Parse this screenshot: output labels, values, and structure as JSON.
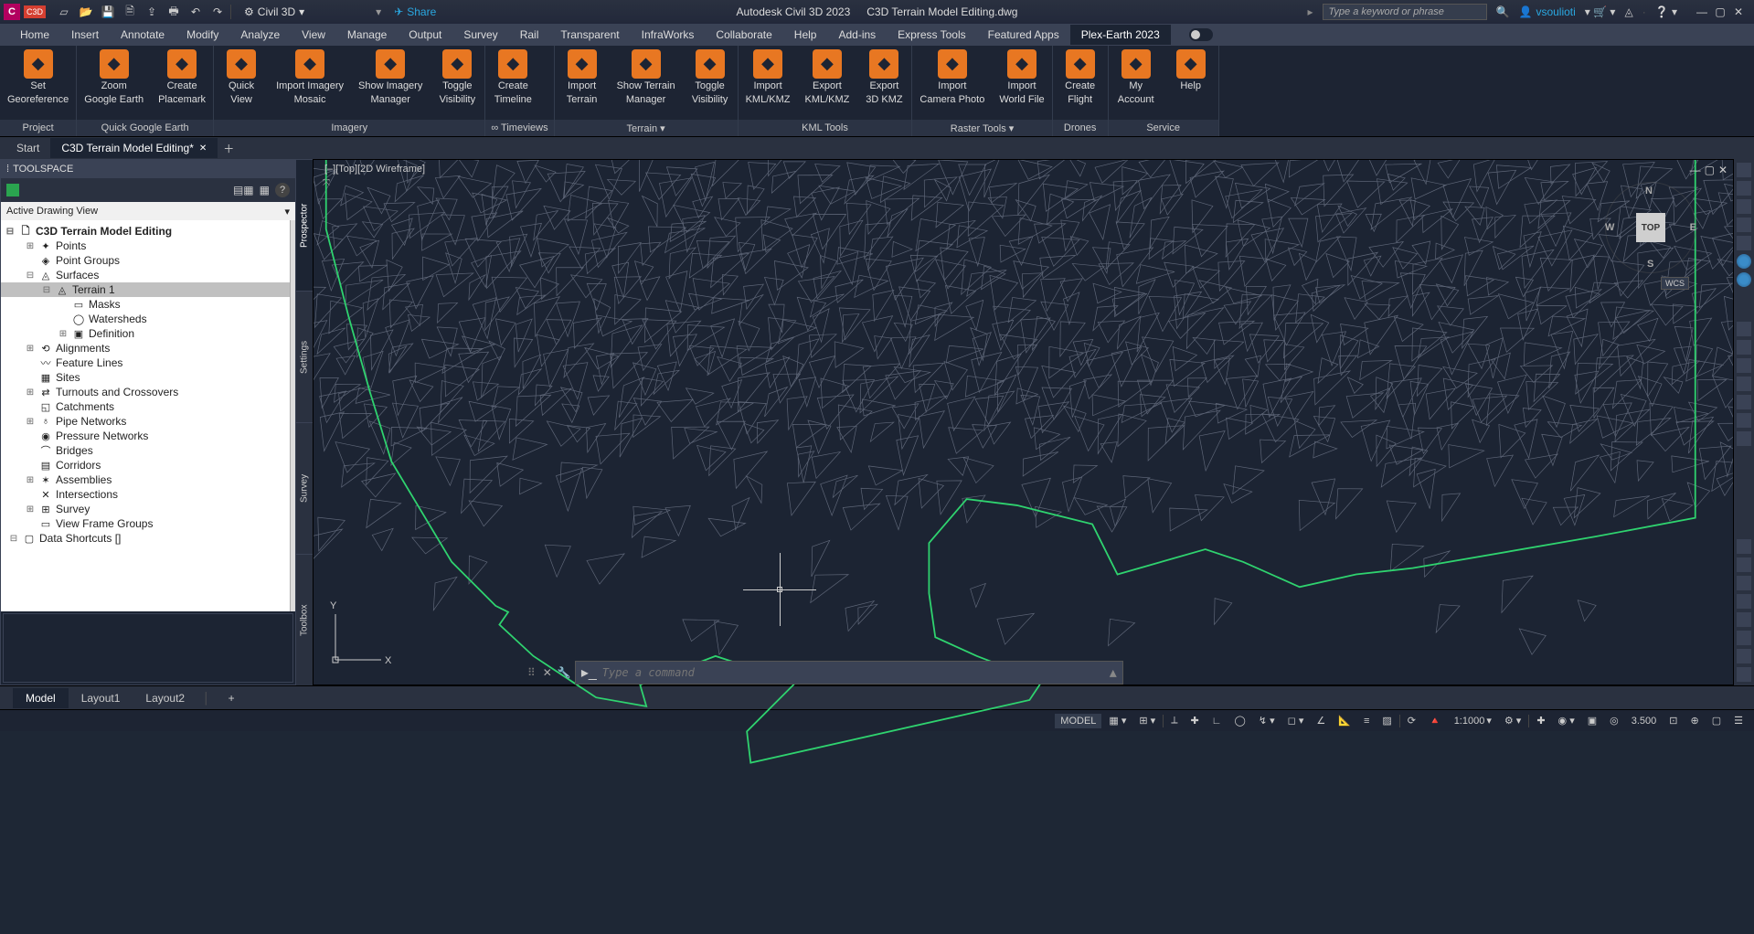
{
  "title_bar": {
    "workspace": "Civil 3D",
    "share": "Share",
    "app": "Autodesk Civil 3D 2023",
    "document": "C3D Terrain Model Editing.dwg",
    "search_placeholder": "Type a keyword or phrase",
    "user": "vsoulioti"
  },
  "menu": [
    "Home",
    "Insert",
    "Annotate",
    "Modify",
    "Analyze",
    "View",
    "Manage",
    "Output",
    "Survey",
    "Rail",
    "Transparent",
    "InfraWorks",
    "Collaborate",
    "Help",
    "Add-ins",
    "Express Tools",
    "Featured Apps",
    "Plex-Earth 2023"
  ],
  "menu_active": 17,
  "ribbon": [
    {
      "label": "Project",
      "buttons": [
        "Set\nGeoreference"
      ]
    },
    {
      "label": "Quick Google Earth",
      "buttons": [
        "Zoom\nGoogle Earth",
        "Create\nPlacemark"
      ]
    },
    {
      "label": "Imagery",
      "buttons": [
        "Quick\nView",
        "Import Imagery\nMosaic",
        "Show Imagery\nManager",
        "Toggle\nVisibility"
      ]
    },
    {
      "label": "∞ Timeviews",
      "buttons": [
        "Create\nTimeline"
      ]
    },
    {
      "label": "Terrain ▾",
      "buttons": [
        "Import\nTerrain",
        "Show Terrain\nManager",
        "Toggle\nVisibility"
      ]
    },
    {
      "label": "KML Tools",
      "buttons": [
        "Import\nKML/KMZ",
        "Export\nKML/KMZ",
        "Export\n3D KMZ"
      ]
    },
    {
      "label": "Raster Tools ▾",
      "buttons": [
        "Import\nCamera Photo",
        "Import\nWorld File"
      ]
    },
    {
      "label": "Drones",
      "buttons": [
        "Create\nFlight"
      ]
    },
    {
      "label": "Service",
      "buttons": [
        "My\nAccount",
        "Help"
      ]
    }
  ],
  "doc_tabs": {
    "start": "Start",
    "active": "C3D Terrain Model Editing*"
  },
  "toolspace": {
    "title": "TOOLSPACE",
    "view": "Active Drawing View",
    "side_tabs": [
      "Prospector",
      "Settings",
      "Survey",
      "Toolbox"
    ],
    "tree_root": "C3D Terrain Model Editing",
    "tree": [
      {
        "d": 1,
        "t": "+",
        "ic": "✦",
        "l": "Points"
      },
      {
        "d": 1,
        "t": "",
        "ic": "◈",
        "l": "Point Groups"
      },
      {
        "d": 1,
        "t": "-",
        "ic": "◬",
        "l": "Surfaces"
      },
      {
        "d": 2,
        "t": "-",
        "ic": "◬",
        "l": "Terrain 1",
        "sel": true
      },
      {
        "d": 3,
        "t": "",
        "ic": "▭",
        "l": "Masks"
      },
      {
        "d": 3,
        "t": "",
        "ic": "◯",
        "l": "Watersheds"
      },
      {
        "d": 3,
        "t": "+",
        "ic": "▣",
        "l": "Definition"
      },
      {
        "d": 1,
        "t": "+",
        "ic": "⟲",
        "l": "Alignments"
      },
      {
        "d": 1,
        "t": "",
        "ic": "〰",
        "l": "Feature Lines"
      },
      {
        "d": 1,
        "t": "",
        "ic": "▦",
        "l": "Sites"
      },
      {
        "d": 1,
        "t": "+",
        "ic": "⇄",
        "l": "Turnouts and Crossovers"
      },
      {
        "d": 1,
        "t": "",
        "ic": "◱",
        "l": "Catchments"
      },
      {
        "d": 1,
        "t": "+",
        "ic": "♁",
        "l": "Pipe Networks"
      },
      {
        "d": 1,
        "t": "",
        "ic": "◉",
        "l": "Pressure Networks"
      },
      {
        "d": 1,
        "t": "",
        "ic": "⌒",
        "l": "Bridges"
      },
      {
        "d": 1,
        "t": "",
        "ic": "▤",
        "l": "Corridors"
      },
      {
        "d": 1,
        "t": "+",
        "ic": "✶",
        "l": "Assemblies"
      },
      {
        "d": 1,
        "t": "",
        "ic": "✕",
        "l": "Intersections"
      },
      {
        "d": 1,
        "t": "+",
        "ic": "⊞",
        "l": "Survey"
      },
      {
        "d": 1,
        "t": "",
        "ic": "▭",
        "l": "View Frame Groups"
      },
      {
        "d": 0,
        "t": "-",
        "ic": "▢",
        "l": "Data Shortcuts []"
      }
    ]
  },
  "viewport": {
    "label": "[–][Top][2D Wireframe]",
    "viewcube_face": "TOP",
    "n": "N",
    "s": "S",
    "e": "E",
    "w": "W",
    "wcs": "WCS",
    "ucs_x": "X",
    "ucs_y": "Y"
  },
  "command": {
    "placeholder": "Type a command"
  },
  "layout_tabs": [
    "Model",
    "Layout1",
    "Layout2"
  ],
  "status": {
    "model": "MODEL",
    "scale": "1:1000",
    "decimal": "3.500"
  }
}
